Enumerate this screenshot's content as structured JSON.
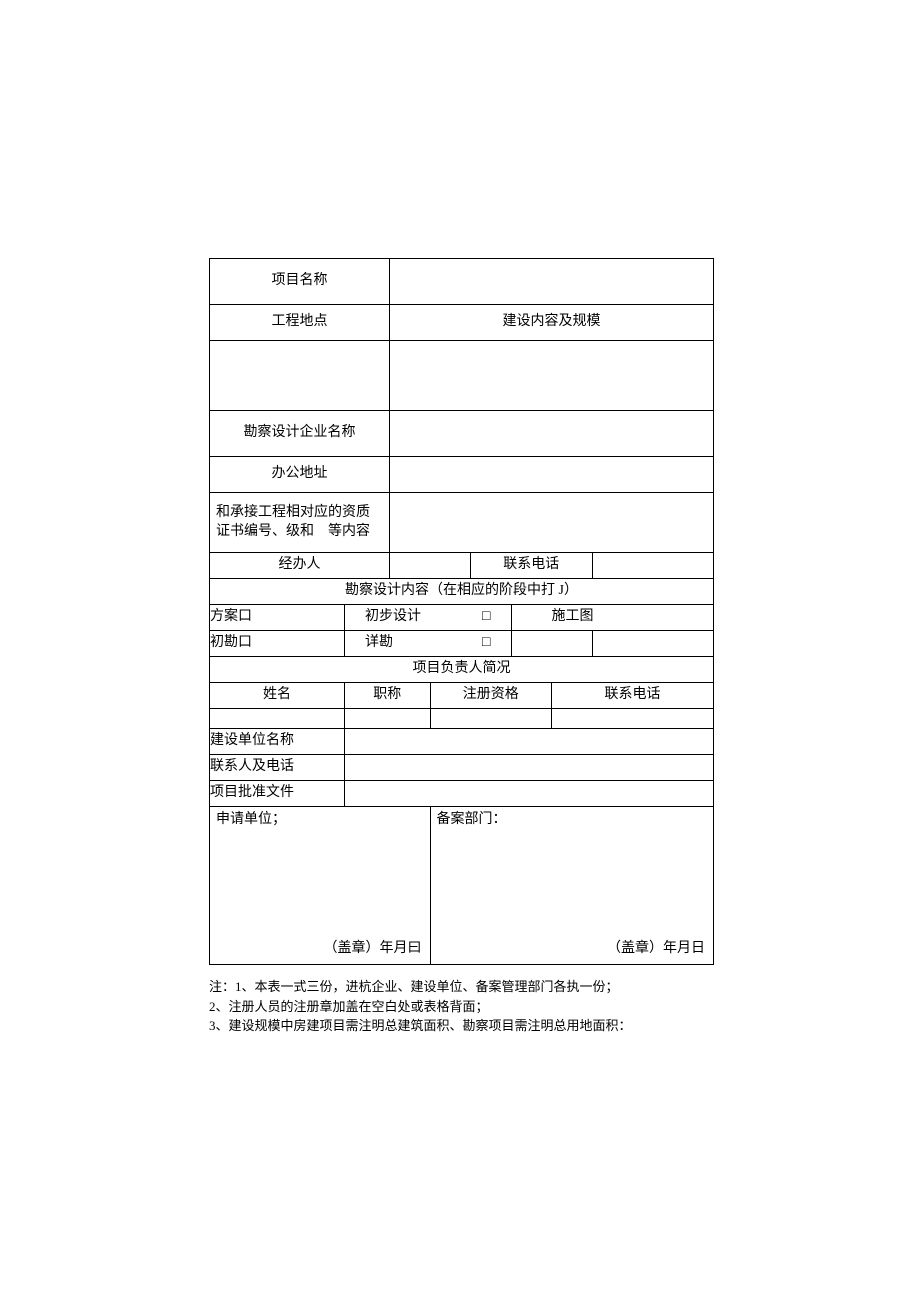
{
  "labels": {
    "projectName": "项目名称",
    "projectLocation": "工程地点",
    "buildContentScale": "建设内容及规模",
    "surveyDesignCompany": "勘察设计企业名称",
    "officeAddress": "办公地址",
    "qualification": "和承接工程相对应的资质证书编号、级和　等内容",
    "handler": "经办人",
    "contactPhone": "联系电话",
    "surveyDesignContentHeader": "勘察设计内容（在相应的阶段中打 J）",
    "scheme": "方案口",
    "preliminaryDesign": "初步设计",
    "constructionDrawing": "施工图",
    "preliminarySurvey": "初勘口",
    "detailedSurvey": "详勘",
    "checkboxSymbol": "□",
    "projectLeaderHeader": "项目负责人简况",
    "name": "姓名",
    "title": "职称",
    "regQualification": "注册资格",
    "phone": "联系电话",
    "buildUnitName": "建设单位名称",
    "contactPersonPhone": "联系人及电话",
    "approvalDoc": "项目批准文件",
    "applicantUnit": "申请单位；",
    "filingDept": "备案部门：",
    "sealDate": "（盖章）年月曰",
    "sealDate2": "（盖章）年月日"
  },
  "notes": {
    "line1": "注：1、本表一式三份，进杭企业、建设单位、备案管理部门各执一份；",
    "line2": "2、注册人员的注册章加盖在空白处或表格背面；",
    "line3": "3、建设规模中房建项目需注明总建筑面积、勘察项目需注明总用地面积："
  }
}
